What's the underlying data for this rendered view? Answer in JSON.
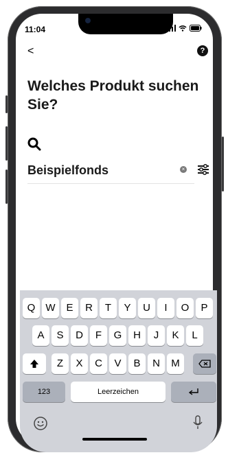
{
  "status": {
    "time": "11:04"
  },
  "nav": {
    "back": "<",
    "help": "?"
  },
  "page": {
    "title": "Welches Produkt suchen Sie?"
  },
  "search": {
    "value": "Beispielfonds",
    "clear": "×"
  },
  "keyboard": {
    "row1": [
      "Q",
      "W",
      "E",
      "R",
      "T",
      "Y",
      "U",
      "I",
      "O",
      "P"
    ],
    "row2": [
      "A",
      "S",
      "D",
      "F",
      "G",
      "H",
      "J",
      "K",
      "L"
    ],
    "row3": [
      "Z",
      "X",
      "C",
      "V",
      "B",
      "N",
      "M"
    ],
    "numbers": "123",
    "space": "Leerzeichen"
  }
}
